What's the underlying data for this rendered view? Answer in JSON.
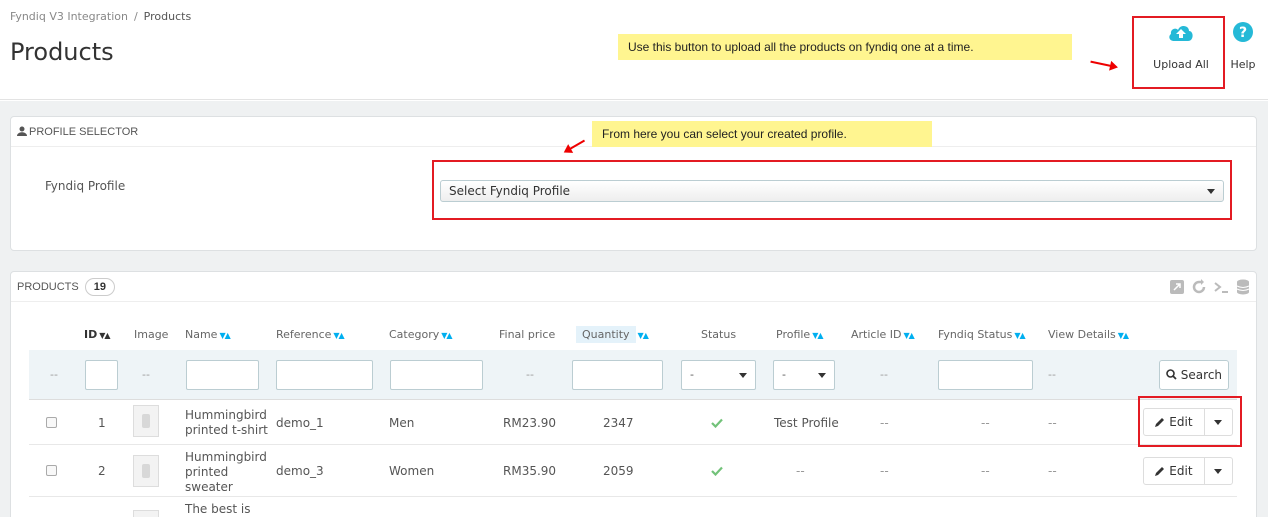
{
  "breadcrumb": {
    "parent": "Fyndiq V3 Integration",
    "separator": "/",
    "current": "Products"
  },
  "page": {
    "title": "Products"
  },
  "toolbar": {
    "upload_label": "Upload All",
    "help_label": "Help"
  },
  "annotations": {
    "upload_note": "Use this button to upload all the products on fyndiq one at a time.",
    "profile_note": "From here you can select your created profile."
  },
  "profile_panel": {
    "heading": "PROFILE SELECTOR",
    "label": "Fyndiq Profile",
    "select_value": "Select Fyndiq Profile"
  },
  "products_panel": {
    "heading": "PRODUCTS",
    "count": "19",
    "columns": [
      "ID",
      "Image",
      "Name",
      "Reference",
      "Category",
      "Final price",
      "Quantity",
      "Status",
      "Profile",
      "Article ID",
      "Fyndiq Status",
      "View Details"
    ],
    "filters": {
      "dash": "--",
      "status_select": "-",
      "profile_select": "-",
      "search_label": "Search"
    },
    "edit_label": "Edit",
    "rows": [
      {
        "id": "1",
        "name": "Hummingbird printed t-shirt",
        "reference": "demo_1",
        "category": "Men",
        "price": "RM23.90",
        "quantity": "2347",
        "profile": "Test Profile",
        "article_id": "--",
        "fyndiq_status": "--",
        "view_details": "--"
      },
      {
        "id": "2",
        "name": "Hummingbird printed sweater",
        "reference": "demo_3",
        "category": "Women",
        "price": "RM35.90",
        "quantity": "2059",
        "profile": "--",
        "article_id": "--",
        "fyndiq_status": "--",
        "view_details": "--"
      },
      {
        "id": "",
        "name": "The best is"
      }
    ]
  },
  "colors": {
    "accent": "#00aff0",
    "success": "#72c279",
    "annotation_red": "#e31b23",
    "note_bg": "#fff590",
    "upload_icon": "#25b9d7"
  }
}
